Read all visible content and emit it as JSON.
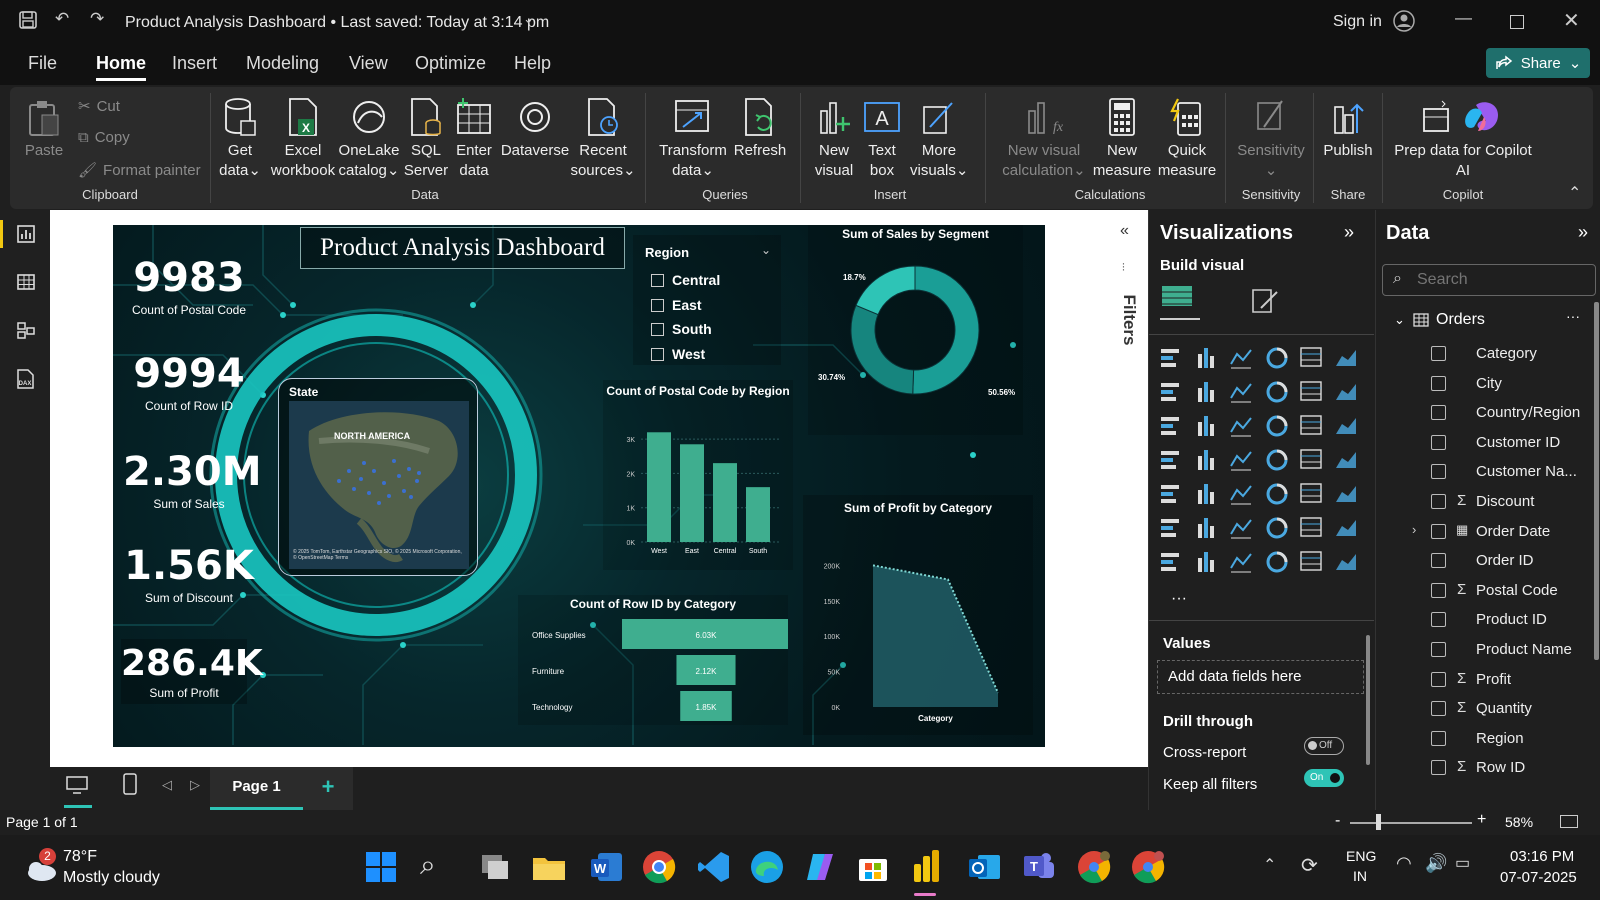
{
  "window": {
    "title": "Product Analysis Dashboard • Last saved: Today at 3:14 pm",
    "sign_in": "Sign in"
  },
  "menu": [
    "File",
    "Home",
    "Insert",
    "Modeling",
    "View",
    "Optimize",
    "Help"
  ],
  "share_label": "Share",
  "ribbon": {
    "clipboard": {
      "paste": "Paste",
      "cut": "Cut",
      "copy": "Copy",
      "format_painter": "Format painter",
      "group": "Clipboard"
    },
    "data": {
      "get_data": [
        "Get",
        "data"
      ],
      "excel": [
        "Excel",
        "workbook"
      ],
      "onelake": [
        "OneLake",
        "catalog"
      ],
      "sql": [
        "SQL",
        "Server"
      ],
      "enter": [
        "Enter",
        "data"
      ],
      "dataverse": "Dataverse",
      "recent": [
        "Recent",
        "sources"
      ],
      "group": "Data"
    },
    "queries": {
      "transform": [
        "Transform",
        "data"
      ],
      "refresh": "Refresh",
      "group": "Queries"
    },
    "insert": {
      "new_visual": [
        "New",
        "visual"
      ],
      "text_box": [
        "Text",
        "box"
      ],
      "more_visuals": [
        "More",
        "visuals"
      ],
      "group": "Insert"
    },
    "calculations": {
      "new_visual_calc": [
        "New visual",
        "calculation"
      ],
      "new_measure": [
        "New",
        "measure"
      ],
      "quick_measure": [
        "Quick",
        "measure"
      ],
      "group": "Calculations"
    },
    "sensitivity": {
      "label": "Sensitivity",
      "group": "Sensitivity"
    },
    "share": {
      "publish": "Publish",
      "group": "Share"
    },
    "copilot": {
      "prep": [
        "Prep data for Copilot",
        "AI"
      ],
      "group": "Copilot"
    }
  },
  "report": {
    "title": "Product Analysis Dashboard",
    "kpis": [
      {
        "value": "9983",
        "label": "Count of Postal Code"
      },
      {
        "value": "9994",
        "label": "Count of Row ID"
      },
      {
        "value": "2.30M",
        "label": "Sum of Sales"
      },
      {
        "value": "1.56K",
        "label": "Sum of Discount"
      },
      {
        "value": "286.4K",
        "label": "Sum of Profit"
      }
    ],
    "slicer": {
      "title": "Region",
      "items": [
        "Central",
        "East",
        "South",
        "West"
      ]
    },
    "map": {
      "title": "State",
      "continent": "NORTH AMERICA",
      "credit": "© 2025 TomTom, Earthstar Geographics SIO, © 2025 Microsoft Corporation, © OpenStreetMap Terms"
    }
  },
  "chart_data": [
    {
      "type": "pie",
      "title": "Sum of Sales by Segment",
      "values": [
        50.56,
        30.74,
        18.7
      ],
      "data_labels": [
        "50.56%",
        "30.74%",
        "18.7%"
      ],
      "colors": [
        "#1a9e96",
        "#16857e",
        "#2ec4b6"
      ]
    },
    {
      "type": "bar",
      "title": "Count of Postal Code by Region",
      "categories": [
        "West",
        "East",
        "Central",
        "South"
      ],
      "values": [
        3200,
        2850,
        2300,
        1600
      ],
      "yticks": [
        "0K",
        "1K",
        "2K",
        "3K"
      ],
      "ylim": [
        0,
        3500
      ],
      "color": "#3fae8f"
    },
    {
      "type": "bar",
      "orientation": "horizontal",
      "title": "Count of Row ID by Category",
      "categories": [
        "Office Supplies",
        "Furniture",
        "Technology"
      ],
      "values": [
        6030,
        2120,
        1850
      ],
      "data_labels": [
        "6.03K",
        "2.12K",
        "1.85K"
      ],
      "color": "#3fae8f"
    },
    {
      "type": "area",
      "title": "Sum of Profit by Category",
      "xlabel": "Category",
      "values": [
        200000,
        180000,
        20000
      ],
      "yticks": [
        "0K",
        "50K",
        "100K",
        "150K",
        "200K"
      ],
      "ylim": [
        0,
        240000
      ],
      "color": "#1f5a63"
    }
  ],
  "pages": {
    "current": "Page 1",
    "status": "Page 1 of 1"
  },
  "filters_label": "Filters",
  "viz": {
    "title": "Visualizations",
    "build": "Build visual",
    "values": "Values",
    "add_fields": "Add data fields here",
    "drill": "Drill through",
    "cross": "Cross-report",
    "cross_state": "Off",
    "keep": "Keep all filters",
    "keep_state": "On"
  },
  "datapane": {
    "title": "Data",
    "search_placeholder": "Search",
    "table": "Orders",
    "fields": [
      {
        "name": "Category",
        "sigma": false
      },
      {
        "name": "City",
        "sigma": false
      },
      {
        "name": "Country/Region",
        "sigma": false
      },
      {
        "name": "Customer ID",
        "sigma": false
      },
      {
        "name": "Customer Na...",
        "sigma": false
      },
      {
        "name": "Discount",
        "sigma": true
      },
      {
        "name": "Order Date",
        "sigma": false
      },
      {
        "name": "Order ID",
        "sigma": false
      },
      {
        "name": "Postal Code",
        "sigma": true
      },
      {
        "name": "Product ID",
        "sigma": false
      },
      {
        "name": "Product Name",
        "sigma": false
      },
      {
        "name": "Profit",
        "sigma": true
      },
      {
        "name": "Quantity",
        "sigma": true
      },
      {
        "name": "Region",
        "sigma": false
      },
      {
        "name": "Row ID",
        "sigma": true
      }
    ]
  },
  "zoom": "58%",
  "taskbar": {
    "temp": "78°F",
    "weather": "Mostly cloudy",
    "badge": "2",
    "lang1": "ENG",
    "lang2": "IN",
    "time": "03:16 PM",
    "date": "07-07-2025"
  }
}
